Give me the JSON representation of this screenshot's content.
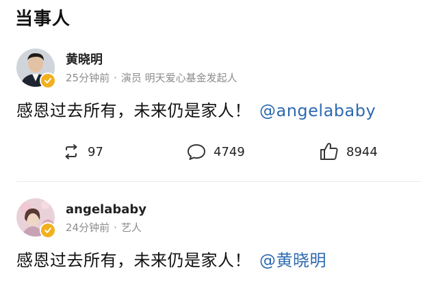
{
  "section_title": "当事人",
  "posts": [
    {
      "author": "黄晓明",
      "meta_time": "25分钟前",
      "meta_separator": "·",
      "meta_desc": "演员 明天爱心基金发起人",
      "text": "感恩过去所有，未来仍是家人！",
      "mention": "@angelababy",
      "reposts": "97",
      "comments": "4749",
      "likes": "8944",
      "avatar_icon": "avatar-man-icon",
      "badge_icon": "verified-badge-icon"
    },
    {
      "author": "angelababy",
      "meta_time": "24分钟前",
      "meta_separator": "·",
      "meta_desc": "艺人",
      "text": "感恩过去所有，未来仍是家人！",
      "mention": "@黄晓明",
      "avatar_icon": "avatar-woman-icon",
      "badge_icon": "verified-badge-icon"
    }
  ],
  "colors": {
    "mention": "#2d6ab0",
    "meta": "#8c8c8c",
    "badge": "#f2b01e"
  }
}
